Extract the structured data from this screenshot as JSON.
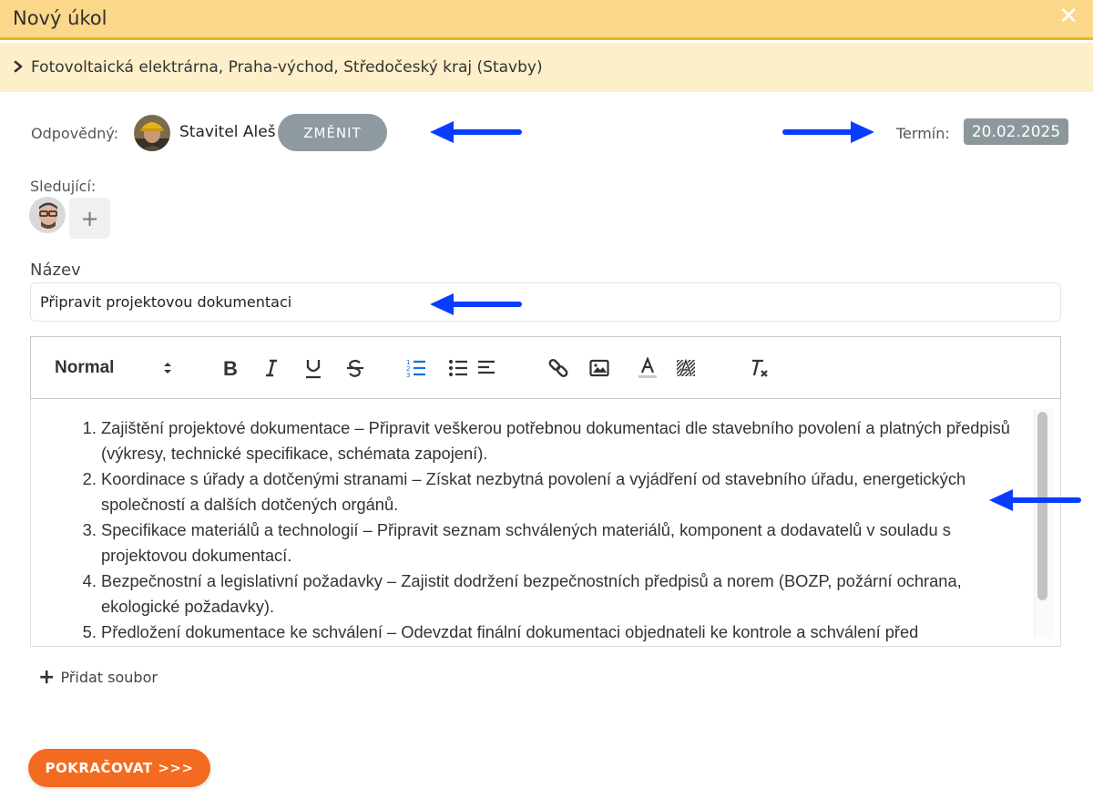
{
  "dialog": {
    "title": "Nový úkol",
    "close_icon": "close-icon"
  },
  "breadcrumb": {
    "text": "Fotovoltaická elektrárna, Praha-východ, Středočeský kraj (Stavby)"
  },
  "responsible": {
    "label": "Odpovědný:",
    "name": "Stavitel Aleš",
    "change_button": "ZMĚNIT"
  },
  "deadline": {
    "label": "Termín:",
    "date": "20.02.2025"
  },
  "followers": {
    "label": "Sledující:",
    "add_label": "+"
  },
  "task_title": {
    "label": "Název",
    "value": "Připravit projektovou dokumentaci"
  },
  "editor": {
    "format_select": "Normal",
    "content": [
      "Zajištění projektové dokumentace – Připravit veškerou potřebnou dokumentaci dle stavebního povolení a platných předpisů (výkresy, technické specifikace, schémata zapojení).",
      "Koordinace s úřady a dotčenými stranami – Získat nezbytná povolení a vyjádření od stavebního úřadu, energetických společností a dalších dotčených orgánů.",
      "Specifikace materiálů a technologií – Připravit seznam schválených materiálů, komponent a dodavatelů v souladu s projektovou dokumentací.",
      "Bezpečnostní a legislativní požadavky – Zajistit dodržení bezpečnostních předpisů a norem (BOZP, požární ochrana, ekologické požadavky).",
      "Předložení dokumentace ke schválení – Odevzdat finální dokumentaci objednateli ke kontrole a schválení před"
    ]
  },
  "attachments": {
    "add_label": "Přidat soubor"
  },
  "actions": {
    "continue_label": "POKRAČOVAT >>>"
  },
  "colors": {
    "header_bg": "#fbd88a",
    "header_border": "#f3b418",
    "breadcrumb_bg": "#fdefc9",
    "primary_button": "#f36b20",
    "annotation_arrow": "#0a3cff"
  }
}
